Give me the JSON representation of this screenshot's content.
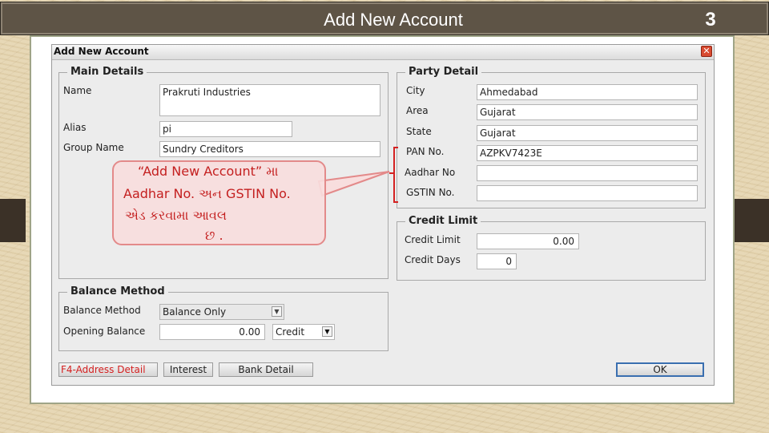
{
  "slide": {
    "title": "Add New Account",
    "number": "3"
  },
  "window": {
    "title": "Add New Account",
    "close_glyph": "✕"
  },
  "main_details": {
    "title": "Main Details",
    "name_label": "Name",
    "name_value": "Prakruti Industries",
    "alias_label": "Alias",
    "alias_value": "pi",
    "group_label": "Group  Name",
    "group_value": "Sundry Creditors"
  },
  "party_detail": {
    "title": "Party Detail",
    "city_label": "City",
    "city_value": "Ahmedabad",
    "area_label": "Area",
    "area_value": "Gujarat",
    "state_label": "State",
    "state_value": "Gujarat",
    "pan_label": "PAN No.",
    "pan_value": "AZPKV7423E",
    "aadhar_label": "Aadhar No",
    "aadhar_value": "",
    "gstin_label": "GSTIN No.",
    "gstin_value": ""
  },
  "credit_limit": {
    "title": "Credit Limit",
    "limit_label": "Credit Limit",
    "limit_value": "0.00",
    "days_label": "Credit Days",
    "days_value": "0"
  },
  "balance_method": {
    "title": "Balance Method",
    "method_label": "Balance Method",
    "method_value": "Balance Only",
    "opening_label": "Opening Balance",
    "opening_value": "0.00",
    "type_value": "Credit"
  },
  "buttons": {
    "address": "F4-Address Detail",
    "interest": "Interest",
    "bank": "Bank Detail",
    "ok": "OK"
  },
  "callout": {
    "line1": "“Add New Account” મા",
    "line2": "Aadhar No. અન  GSTIN No.",
    "line3": "એડ કરવામા      આવલ",
    "line4": "છ ."
  },
  "colors": {
    "callout_text": "#c42020",
    "callout_border": "#e38a8a",
    "callout_fill": "#f8dede",
    "title_bar": "#5e5446"
  },
  "icons": {
    "close": "close-icon",
    "dropdown": "chevron-down-icon"
  }
}
